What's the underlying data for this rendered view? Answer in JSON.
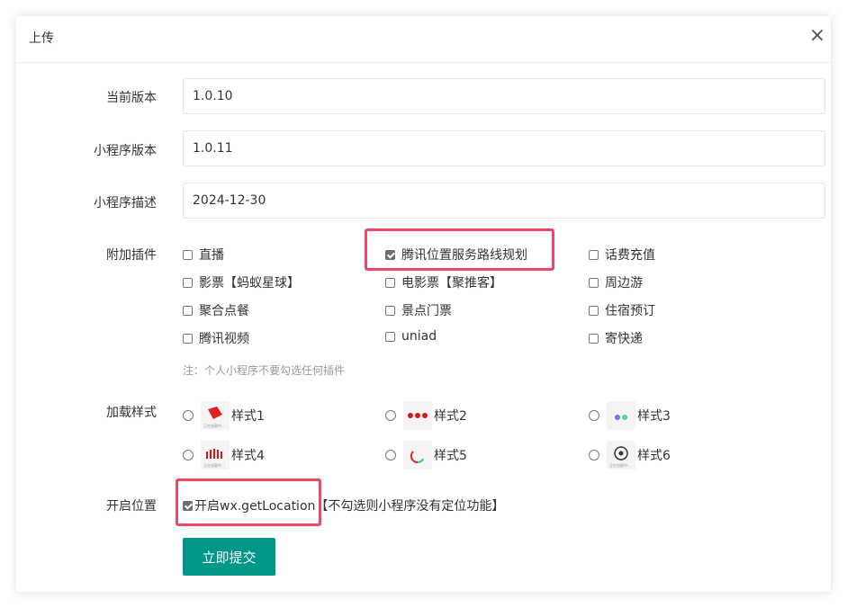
{
  "dialog": {
    "title": "上传",
    "close_icon": "×"
  },
  "form": {
    "current_version": {
      "label": "当前版本",
      "value": "1.0.10"
    },
    "mini_version": {
      "label": "小程序版本",
      "value": "1.0.11"
    },
    "mini_desc": {
      "label": "小程序描述",
      "value": "2024-12-30"
    },
    "plugins": {
      "label": "附加插件",
      "items": [
        {
          "label": "直播",
          "checked": false
        },
        {
          "label": "腾讯位置服务路线规划",
          "checked": true
        },
        {
          "label": "话费充值",
          "checked": false
        },
        {
          "label": "影票【蚂蚁星球】",
          "checked": false
        },
        {
          "label": "电影票【聚推客】",
          "checked": false
        },
        {
          "label": "周边游",
          "checked": false
        },
        {
          "label": "聚合点餐",
          "checked": false
        },
        {
          "label": "景点门票",
          "checked": false
        },
        {
          "label": "住宿预订",
          "checked": false
        },
        {
          "label": "腾讯视频",
          "checked": false
        },
        {
          "label": "uniad",
          "checked": false
        },
        {
          "label": "寄快递",
          "checked": false
        }
      ],
      "note": "注：个人小程序不要勾选任何插件"
    },
    "loading_style": {
      "label": "加载样式",
      "options": [
        {
          "label": "样式1",
          "selected": false
        },
        {
          "label": "样式2",
          "selected": false
        },
        {
          "label": "样式3",
          "selected": false
        },
        {
          "label": "样式4",
          "selected": false
        },
        {
          "label": "样式5",
          "selected": false
        },
        {
          "label": "样式6",
          "selected": false
        }
      ],
      "thumb_caption": "正在加载中..."
    },
    "location": {
      "label": "开启位置",
      "checkbox_label": "开启wx.getLocation",
      "hint": "【不勾选则小程序没有定位功能】",
      "checked": true
    },
    "submit_label": "立即提交"
  },
  "colors": {
    "accent": "#009688",
    "highlight": "#f04864"
  }
}
